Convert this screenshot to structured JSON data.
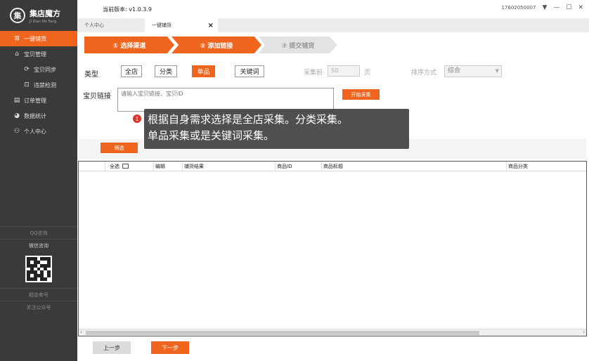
{
  "app": {
    "title": "集店魔方",
    "subtitle": "JI Dian Mo Fang",
    "logo_char": "集"
  },
  "sidebar": {
    "items": [
      {
        "label": "一键铺货",
        "icon": "⊞",
        "active": true
      },
      {
        "label": "宝贝管理",
        "icon": "⌂"
      },
      {
        "label": "宝贝同步",
        "icon": "⟳",
        "sub": true
      },
      {
        "label": "违禁检测",
        "icon": "⊡",
        "sub": true
      },
      {
        "label": "订单管理",
        "icon": "▤"
      },
      {
        "label": "数据统计",
        "icon": "◕"
      },
      {
        "label": "个人中心",
        "icon": "⚇"
      }
    ],
    "qq_label": "QQ咨询",
    "wechat_label": "微信咨询",
    "sell_label": "超会卖号",
    "follow_label": "关注公众号"
  },
  "topbar": {
    "version": "当前版本: v1.0.3.9",
    "user": "17602050007"
  },
  "tabs": [
    {
      "label": "个人中心"
    },
    {
      "label": "一键铺货",
      "active": true,
      "close": "×"
    }
  ],
  "steps": [
    {
      "label": "① 选择渠道"
    },
    {
      "label": "② 添加链接"
    },
    {
      "label": "③ 提交铺货"
    }
  ],
  "form": {
    "type_label": "类型",
    "type_options": [
      "全店",
      "分类",
      "单品",
      "关键词"
    ],
    "type_selected": "单品",
    "collect_prefix": "采集前",
    "collect_value": "50",
    "collect_unit": "页",
    "sort_label": "排序方式",
    "sort_value": "综合",
    "link_label": "宝贝链接",
    "link_placeholder": "请输入宝贝链接、宝贝ID",
    "start_button": "开始采集",
    "filter_button": "筛选"
  },
  "tooltip": {
    "badge": "1",
    "line1": "根据自身需求选择是全店采集。分类采集。",
    "line2": "单品采集或是关键词采集。"
  },
  "table": {
    "columns": [
      "全选",
      "编辑",
      "铺货结果",
      "商品ID",
      "商品标题",
      "商品分类"
    ]
  },
  "footer": {
    "prev": "上一步",
    "next": "下一步"
  },
  "colors": {
    "accent": "#f0651e",
    "sidebar": "#3a3a3a"
  }
}
